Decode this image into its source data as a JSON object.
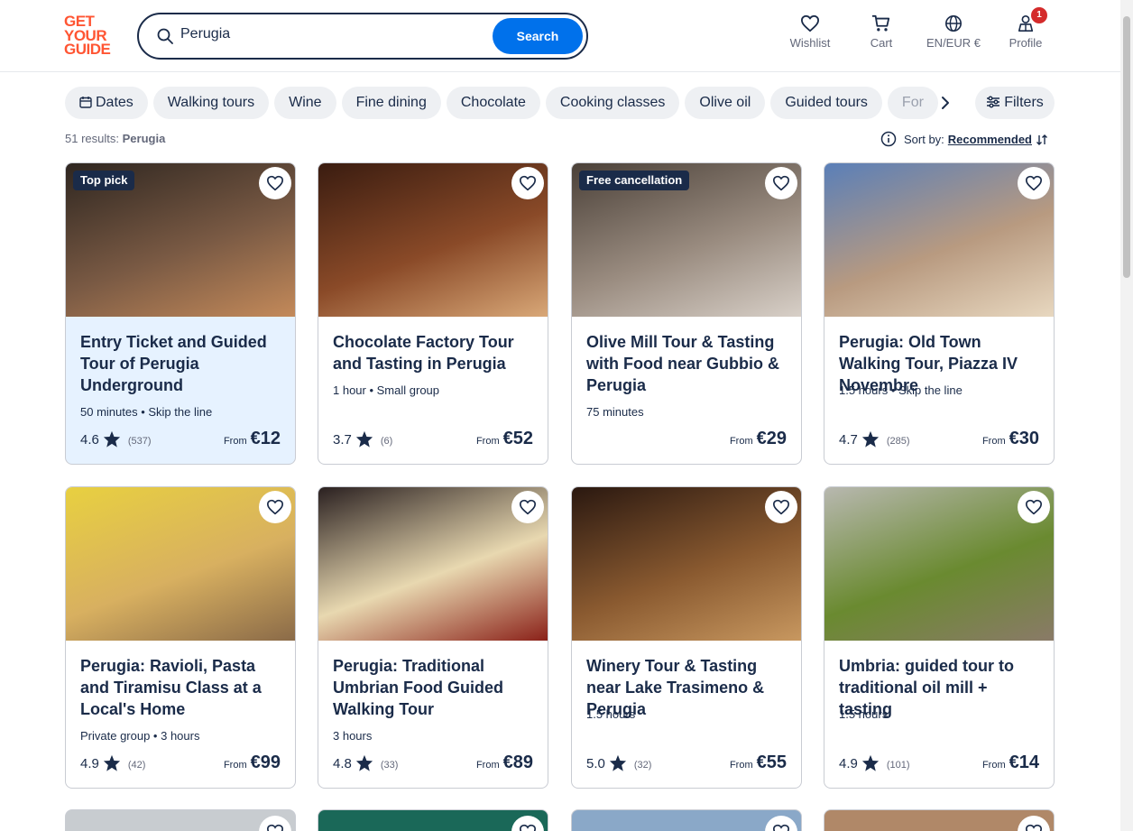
{
  "header": {
    "logo_lines": [
      "GET",
      "YOUR",
      "GUIDE"
    ],
    "search_value": "Perugia",
    "search_button": "Search",
    "wishlist": "Wishlist",
    "cart": "Cart",
    "language": "EN/EUR €",
    "profile": "Profile",
    "profile_badge": "1"
  },
  "chips": [
    "Dates",
    "Walking tours",
    "Wine",
    "Fine dining",
    "Chocolate",
    "Cooking classes",
    "Olive oil",
    "Guided tours",
    "For"
  ],
  "filters_label": "Filters",
  "results": {
    "count": "51 results:",
    "query": "Perugia"
  },
  "sort": {
    "label": "Sort by:",
    "value": "Recommended"
  },
  "cards": [
    {
      "tag": "Top pick",
      "title": "Entry Ticket and Guided Tour of Perugia Underground",
      "meta": "50 minutes • Skip the line",
      "rating": "4.6",
      "count": "(537)",
      "from": "From",
      "price": "€12",
      "colors": [
        "#2e2620",
        "#7a5a44",
        "#c48a5a"
      ]
    },
    {
      "tag": "",
      "title": "Chocolate Factory Tour and Tasting in Perugia",
      "meta": "1 hour • Small group",
      "rating": "3.7",
      "count": "(6)",
      "from": "From",
      "price": "€52",
      "colors": [
        "#3a1c10",
        "#8a4a28",
        "#d9a878"
      ]
    },
    {
      "tag": "Free cancellation",
      "title": "Olive Mill Tour & Tasting with Food near Gubbio & Perugia",
      "meta": "75 minutes",
      "rating": "",
      "count": "",
      "from": "From",
      "price": "€29",
      "colors": [
        "#4a4038",
        "#9a8c80",
        "#d8d0c8"
      ]
    },
    {
      "tag": "",
      "title": "Perugia: Old Town Walking Tour, Piazza IV Novembre",
      "meta": "1.5 hours • Skip the line",
      "rating": "4.7",
      "count": "(285)",
      "from": "From",
      "price": "€30",
      "colors": [
        "#5a7fb8",
        "#b89a80",
        "#e8d8c0"
      ]
    },
    {
      "tag": "",
      "title": "Perugia: Ravioli, Pasta and Tiramisu Class at a Local's Home",
      "meta": "Private group • 3 hours",
      "rating": "4.9",
      "count": "(42)",
      "from": "From",
      "price": "€99",
      "colors": [
        "#e8d040",
        "#d8b060",
        "#8a6a48"
      ]
    },
    {
      "tag": "",
      "title": "Perugia: Traditional Umbrian Food Guided Walking Tour",
      "meta": "3 hours",
      "rating": "4.8",
      "count": "(33)",
      "from": "From",
      "price": "€89",
      "colors": [
        "#2a2020",
        "#e8d8b0",
        "#8a2018"
      ]
    },
    {
      "tag": "",
      "title": "Winery Tour & Tasting near Lake Trasimeno & Perugia",
      "meta": "1.5 hours",
      "rating": "5.0",
      "count": "(32)",
      "from": "From",
      "price": "€55",
      "colors": [
        "#2a1810",
        "#8a5a30",
        "#c89860"
      ]
    },
    {
      "tag": "",
      "title": "Umbria: guided tour to traditional oil mill + tasting",
      "meta": "1.5 hours",
      "rating": "4.9",
      "count": "(101)",
      "from": "From",
      "price": "€14",
      "colors": [
        "#b8b8b0",
        "#6a8a30",
        "#8a7a68"
      ]
    }
  ],
  "partial_colors": [
    "#c8ccd0",
    "#1a6858",
    "#8aa8c8",
    "#b08868"
  ]
}
